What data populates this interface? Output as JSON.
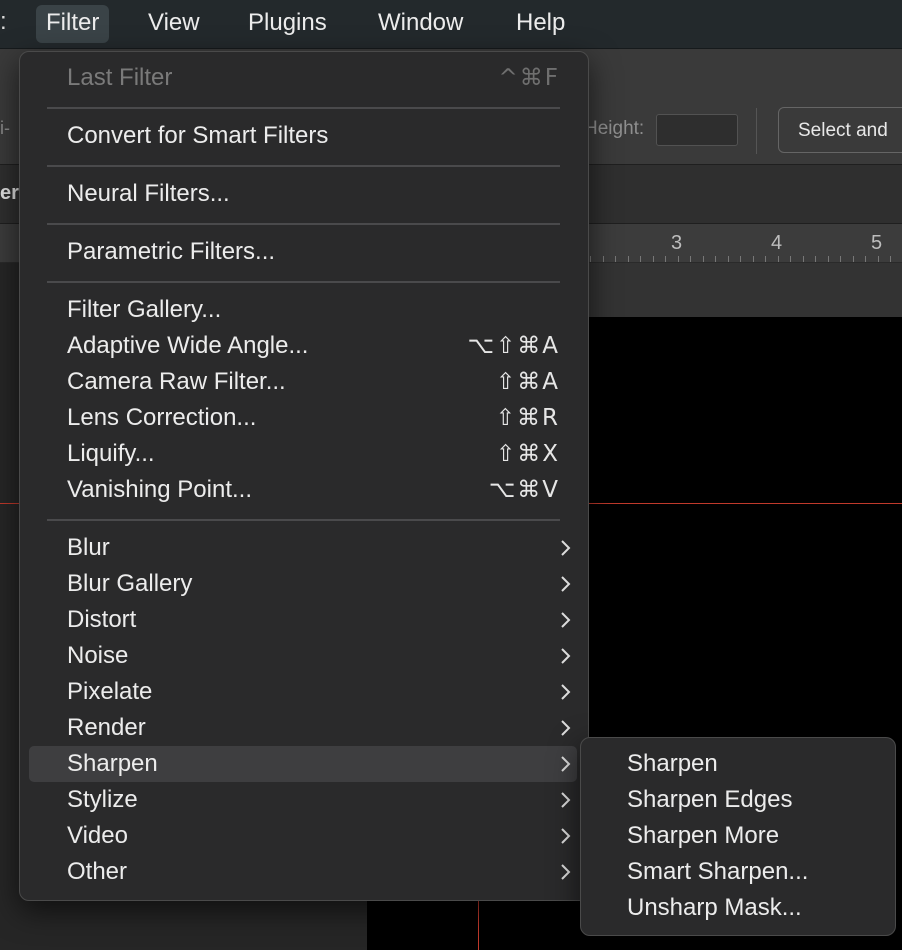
{
  "menubar": {
    "cut_text": ":",
    "items": [
      {
        "label": "Filter",
        "active": true
      },
      {
        "label": "View"
      },
      {
        "label": "Plugins"
      },
      {
        "label": "Window"
      },
      {
        "label": "Help"
      }
    ]
  },
  "background": {
    "left_option_text": "i-",
    "height_label": "Height:",
    "height_value": "",
    "select_button": "Select and",
    "left_clipped_label": "er",
    "ruler_numbers": [
      "3",
      "4",
      "5"
    ],
    "guide_color": "#c0392b"
  },
  "filter_menu": {
    "items": [
      {
        "label": "Last Filter",
        "shortcut": "^⌘F",
        "disabled": true
      },
      {
        "label": "Convert for Smart Filters"
      },
      {
        "label": "Neural Filters..."
      },
      {
        "label": "Parametric Filters..."
      },
      {
        "label": "Filter Gallery..."
      },
      {
        "label": "Adaptive Wide Angle...",
        "shortcut": "⌥⇧⌘A"
      },
      {
        "label": "Camera Raw Filter...",
        "shortcut": "⇧⌘A"
      },
      {
        "label": "Lens Correction...",
        "shortcut": "⇧⌘R"
      },
      {
        "label": "Liquify...",
        "shortcut": "⇧⌘X"
      },
      {
        "label": "Vanishing Point...",
        "shortcut": "⌥⌘V"
      },
      {
        "label": "Blur",
        "submenu": true
      },
      {
        "label": "Blur Gallery",
        "submenu": true
      },
      {
        "label": "Distort",
        "submenu": true
      },
      {
        "label": "Noise",
        "submenu": true
      },
      {
        "label": "Pixelate",
        "submenu": true
      },
      {
        "label": "Render",
        "submenu": true
      },
      {
        "label": "Sharpen",
        "submenu": true,
        "highlighted": true
      },
      {
        "label": "Stylize",
        "submenu": true
      },
      {
        "label": "Video",
        "submenu": true
      },
      {
        "label": "Other",
        "submenu": true
      }
    ]
  },
  "sharpen_submenu": {
    "items": [
      {
        "label": "Sharpen"
      },
      {
        "label": "Sharpen Edges"
      },
      {
        "label": "Sharpen More"
      },
      {
        "label": "Smart Sharpen..."
      },
      {
        "label": "Unsharp Mask..."
      }
    ]
  }
}
